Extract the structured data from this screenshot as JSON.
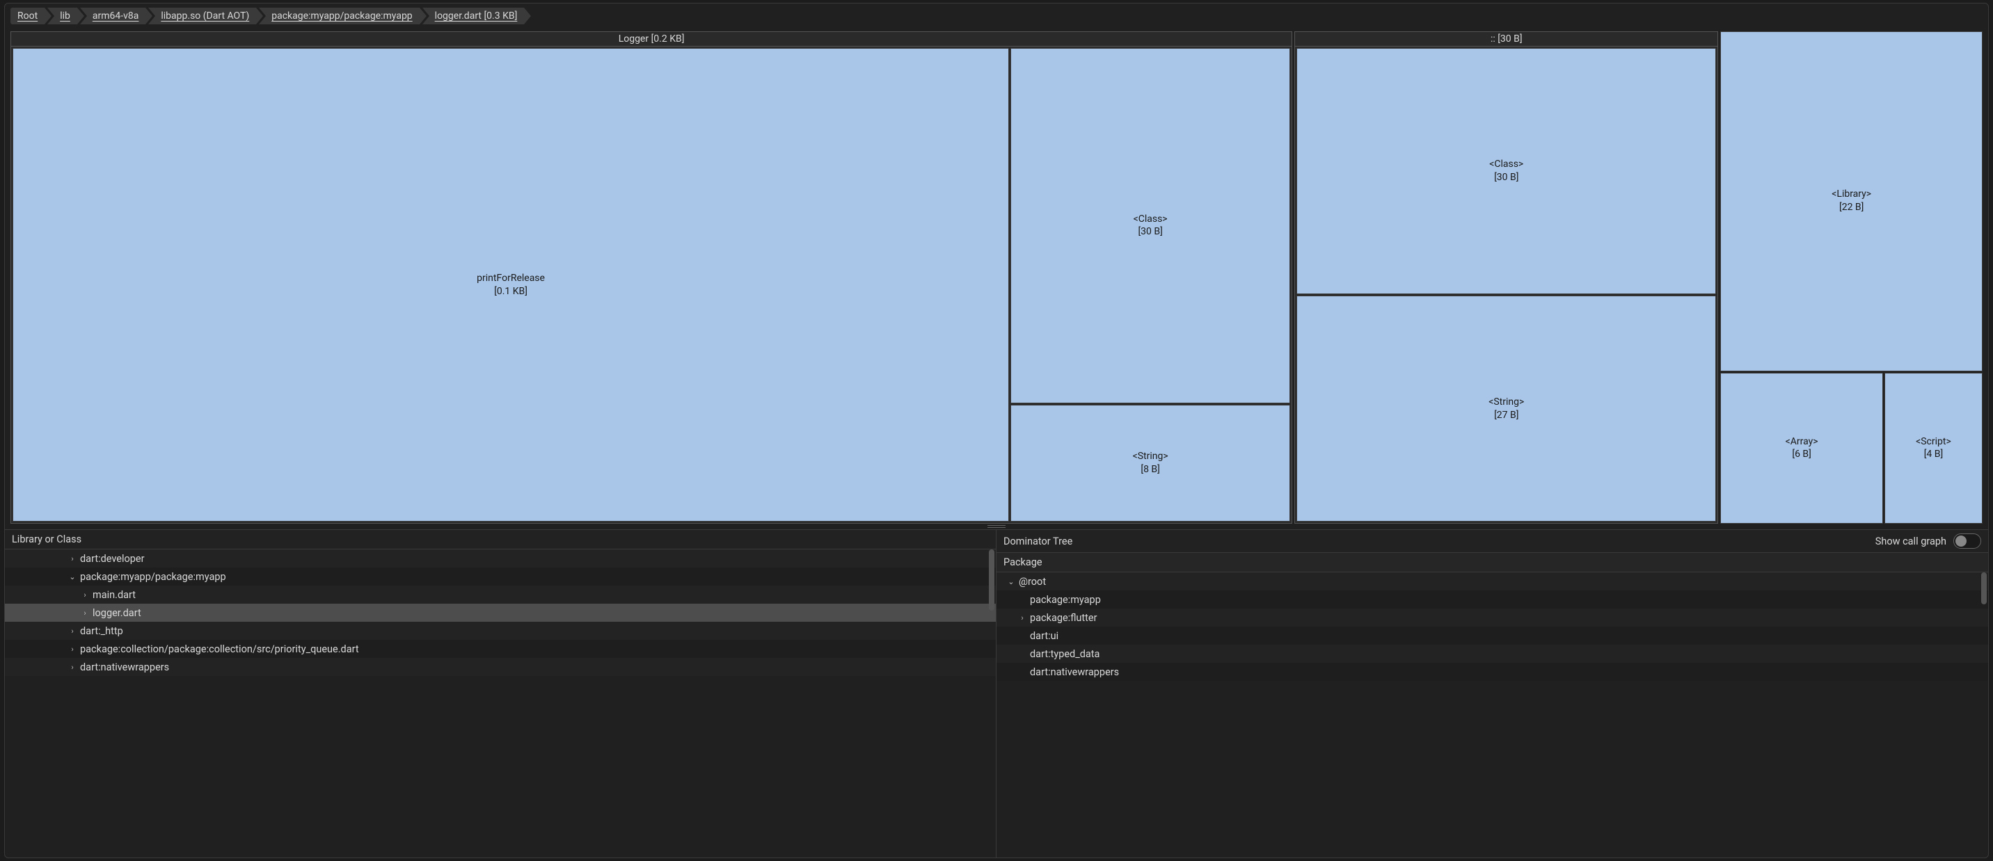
{
  "breadcrumbs": [
    {
      "label": "Root"
    },
    {
      "label": "lib"
    },
    {
      "label": "arm64-v8a"
    },
    {
      "label": "libapp.so (Dart AOT)"
    },
    {
      "label": "package:myapp/package:myapp"
    },
    {
      "label": "logger.dart [0.3 KB]"
    }
  ],
  "treemap": {
    "left": {
      "header": "Logger [0.2 KB]",
      "big": {
        "name": "printForRelease",
        "size": "[0.1 KB]"
      },
      "class": {
        "name": "<Class>",
        "size": "[30 B]"
      },
      "string": {
        "name": "<String>",
        "size": "[8 B]"
      }
    },
    "mid": {
      "header": ":: [30 B]",
      "class": {
        "name": "<Class>",
        "size": "[30 B]"
      },
      "string": {
        "name": "<String>",
        "size": "[27 B]"
      }
    },
    "right": {
      "library": {
        "name": "<Library>",
        "size": "[22 B]"
      },
      "array": {
        "name": "<Array>",
        "size": "[6 B]"
      },
      "script": {
        "name": "<Script>",
        "size": "[4 B]"
      }
    }
  },
  "left_panel": {
    "header": "Library or Class",
    "rows": [
      {
        "indent": 1,
        "arrow": "›",
        "label": "dart:developer"
      },
      {
        "indent": 1,
        "arrow": "⌄",
        "label": "package:myapp/package:myapp"
      },
      {
        "indent": 2,
        "arrow": "›",
        "label": "main.dart"
      },
      {
        "indent": 2,
        "arrow": "›",
        "label": "logger.dart",
        "selected": true
      },
      {
        "indent": 1,
        "arrow": "›",
        "label": "dart:_http"
      },
      {
        "indent": 1,
        "arrow": "›",
        "label": "package:collection/package:collection/src/priority_queue.dart"
      },
      {
        "indent": 1,
        "arrow": "›",
        "label": "dart:nativewrappers"
      }
    ]
  },
  "right_panel": {
    "header": "Dominator Tree",
    "toggle_label": "Show call graph",
    "sub_header": "Package",
    "rows": [
      {
        "indent": 0,
        "arrow": "⌄",
        "label": "@root"
      },
      {
        "indent": 1,
        "arrow": "",
        "label": "package:myapp"
      },
      {
        "indent": 1,
        "arrow": "›",
        "label": "package:flutter"
      },
      {
        "indent": 1,
        "arrow": "",
        "label": "dart:ui"
      },
      {
        "indent": 1,
        "arrow": "",
        "label": "dart:typed_data"
      },
      {
        "indent": 1,
        "arrow": "",
        "label": "dart:nativewrappers"
      }
    ]
  },
  "chart_data": {
    "type": "treemap",
    "title": "logger.dart [0.3 KB]",
    "nodes": [
      {
        "name": "Logger",
        "size_bytes": 200,
        "size_label": "0.2 KB",
        "children": [
          {
            "name": "printForRelease",
            "size_bytes": 100,
            "size_label": "0.1 KB"
          },
          {
            "name": "<Class>",
            "size_bytes": 30,
            "size_label": "30 B"
          },
          {
            "name": "<String>",
            "size_bytes": 8,
            "size_label": "8 B"
          }
        ]
      },
      {
        "name": "::",
        "size_bytes": 30,
        "size_label": "30 B",
        "children": [
          {
            "name": "<Class>",
            "size_bytes": 30,
            "size_label": "30 B"
          },
          {
            "name": "<String>",
            "size_bytes": 27,
            "size_label": "27 B"
          }
        ]
      },
      {
        "name": "<Library>",
        "size_bytes": 22,
        "size_label": "22 B"
      },
      {
        "name": "<Array>",
        "size_bytes": 6,
        "size_label": "6 B"
      },
      {
        "name": "<Script>",
        "size_bytes": 4,
        "size_label": "4 B"
      }
    ]
  }
}
